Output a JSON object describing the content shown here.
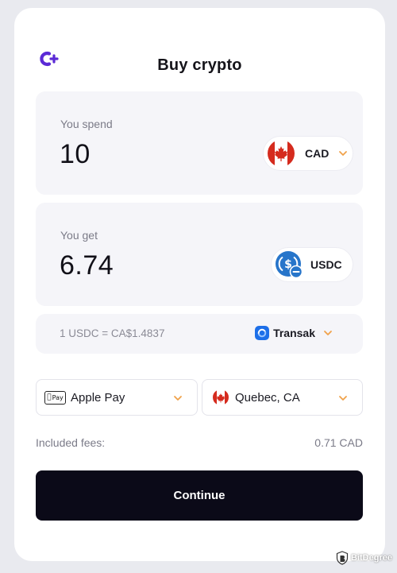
{
  "header": {
    "title": "Buy crypto",
    "logo_icon": "c-plus-logo-icon"
  },
  "spend": {
    "label": "You spend",
    "amount": "10",
    "currency": "CAD",
    "flag_icon": "canada-flag-icon"
  },
  "get": {
    "label": "You get",
    "amount": "6.74",
    "currency": "USDC",
    "coin_icon": "usdc-coin-icon"
  },
  "rate": {
    "text": "1 USDC = CA$1.4837",
    "provider": "Transak",
    "provider_icon": "transak-icon"
  },
  "payment_method": {
    "badge": "Pay",
    "label": "Apple Pay",
    "icon": "apple-pay-icon"
  },
  "region": {
    "label": "Quebec, CA",
    "flag_icon": "canada-flag-icon"
  },
  "fees": {
    "label": "Included fees:",
    "value": "0.71 CAD"
  },
  "continue_label": "Continue",
  "watermark": {
    "text": "BitDegree"
  },
  "colors": {
    "accent": "#5b2ad6",
    "chevron": "#f0a24a",
    "button_bg": "#0b0a18",
    "usdc_blue": "#2775ca",
    "canada_red": "#d52b1e"
  }
}
